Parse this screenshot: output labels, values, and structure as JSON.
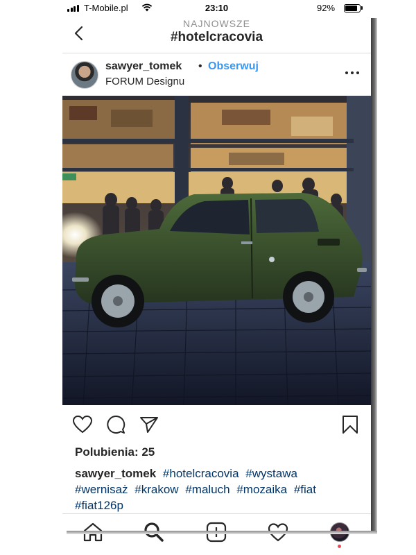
{
  "status_bar": {
    "carrier": "T-Mobile.pl",
    "time": "23:10",
    "battery_percent": "92%",
    "battery_level": 0.92,
    "signal_bars": 4
  },
  "header": {
    "subtitle": "NAJNOWSZE",
    "title": "#hotelcracovia"
  },
  "post": {
    "username": "sawyer_tomek",
    "separator": "•",
    "follow_label": "Obserwuj",
    "location": "FORUM Designu",
    "likes_text": "Polubienia: 25",
    "caption_user": "sawyer_tomek",
    "hashtags": [
      "#hotelcracovia",
      "#wystawa",
      "#wernisaż",
      "#krakow",
      "#maluch",
      "#mozaika",
      "#fiat",
      "#fiat126p"
    ]
  },
  "icons": {
    "back": "chevron-left-icon",
    "more": "more-horizontal-icon",
    "like": "heart-icon",
    "comment": "comment-icon",
    "share": "send-icon",
    "save": "bookmark-icon",
    "nav_home": "home-icon",
    "nav_search": "search-icon",
    "nav_add": "add-post-icon",
    "nav_activity": "heart-icon",
    "nav_profile": "profile-avatar"
  },
  "colors": {
    "accent": "#3897f0",
    "hashtag": "#003569",
    "text": "#262626",
    "secondary": "#8e8e8e",
    "notification": "#ed4956"
  }
}
